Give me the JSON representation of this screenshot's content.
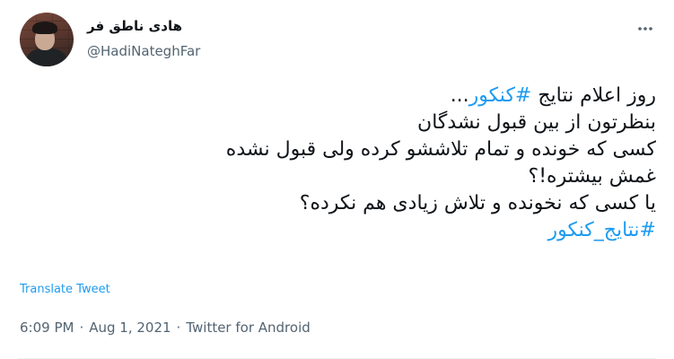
{
  "user": {
    "display_name": "هادی ناطق فر",
    "handle": "@HadiNateghFar"
  },
  "menu": {
    "icon": "more-horizontal-icon"
  },
  "tweet": {
    "line1_prefix": "روز اعلام نتایج ",
    "line1_hashtag": "#کنکور",
    "line1_suffix": "...",
    "line2": "بنظرتون از بین قبول نشدگان",
    "line3": "کسی که خونده و تمام تلاششو کرده ولی قبول نشده",
    "line4": "غمش بیشتره!؟",
    "line5": "یا کسی که نخونده و تلاش زیادی هم نکرده؟",
    "line6_hashtag": "#نتایج_کنکور"
  },
  "translate_label": "Translate Tweet",
  "meta": {
    "time": "6:09 PM",
    "separator": "·",
    "date": "Aug 1, 2021",
    "source": "Twitter for Android"
  },
  "colors": {
    "link": "#1d9bf0",
    "secondary": "#536471",
    "text": "#0f1419"
  }
}
